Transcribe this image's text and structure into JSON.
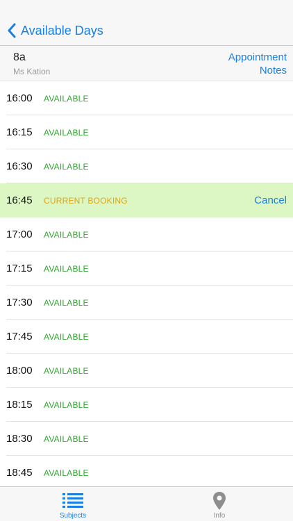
{
  "colors": {
    "accent": "#1a7fe0",
    "available": "#2fa82f",
    "booked_text": "#d9a514",
    "booked_bg": "#dcf7c4",
    "tab_inactive": "#8e8e8e"
  },
  "nav": {
    "back_label": "Available Days"
  },
  "header": {
    "class_name": "8a",
    "teacher": "Ms Kation",
    "appointment_notes_line1": "Appointment",
    "appointment_notes_line2": "Notes"
  },
  "slots": [
    {
      "time": "16:00",
      "status": "AVAILABLE",
      "state": "available",
      "action": ""
    },
    {
      "time": "16:15",
      "status": "AVAILABLE",
      "state": "available",
      "action": ""
    },
    {
      "time": "16:30",
      "status": "AVAILABLE",
      "state": "available",
      "action": ""
    },
    {
      "time": "16:45",
      "status": "CURRENT BOOKING",
      "state": "booked",
      "action": "Cancel"
    },
    {
      "time": "17:00",
      "status": "AVAILABLE",
      "state": "available",
      "action": ""
    },
    {
      "time": "17:15",
      "status": "AVAILABLE",
      "state": "available",
      "action": ""
    },
    {
      "time": "17:30",
      "status": "AVAILABLE",
      "state": "available",
      "action": ""
    },
    {
      "time": "17:45",
      "status": "AVAILABLE",
      "state": "available",
      "action": ""
    },
    {
      "time": "18:00",
      "status": "AVAILABLE",
      "state": "available",
      "action": ""
    },
    {
      "time": "18:15",
      "status": "AVAILABLE",
      "state": "available",
      "action": ""
    },
    {
      "time": "18:30",
      "status": "AVAILABLE",
      "state": "available",
      "action": ""
    },
    {
      "time": "18:45",
      "status": "AVAILABLE",
      "state": "available",
      "action": ""
    }
  ],
  "tabbar": {
    "tabs": [
      {
        "label": "Subjects",
        "icon": "list-icon",
        "active": true
      },
      {
        "label": "Info",
        "icon": "location-pin-icon",
        "active": false
      }
    ]
  }
}
